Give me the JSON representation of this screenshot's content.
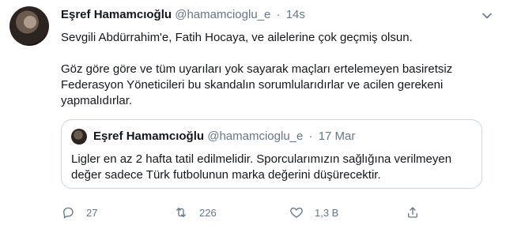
{
  "tweet": {
    "author_name": "Eşref Hamamcıoğlu",
    "handle": "@hamamcioglu_e",
    "separator": "·",
    "time": "14s",
    "paragraph1": "Sevgili Abdürrahim'e, Fatih Hocaya, ve ailelerine çok geçmiş olsun.",
    "paragraph2": "Göz göre göre ve tüm uyarıları yok sayarak maçları ertelemeyen basiretsiz Federasyon Yöneticileri bu skandalın sorumlularıdırlar ve acilen gerekeni yapmalıdırlar."
  },
  "quoted": {
    "author_name": "Eşref Hamamcıoğlu",
    "handle": "@hamamcioglu_e",
    "separator": "·",
    "date": "17 Mar",
    "text": "Ligler en az 2 hafta tatil edilmelidir. Sporcularımızın sağlığına verilmeyen değer sadece Türk futbolunun marka değerini düşürecektir."
  },
  "actions": {
    "reply_count": "27",
    "retweet_count": "226",
    "like_count": "1,3 B"
  },
  "icons": {
    "reply": "reply-icon",
    "retweet": "retweet-icon",
    "like": "heart-icon",
    "share": "share-icon",
    "menu": "chevron-down-icon"
  },
  "colors": {
    "text": "#14171a",
    "muted": "#657786",
    "border": "#ccd6dd"
  }
}
